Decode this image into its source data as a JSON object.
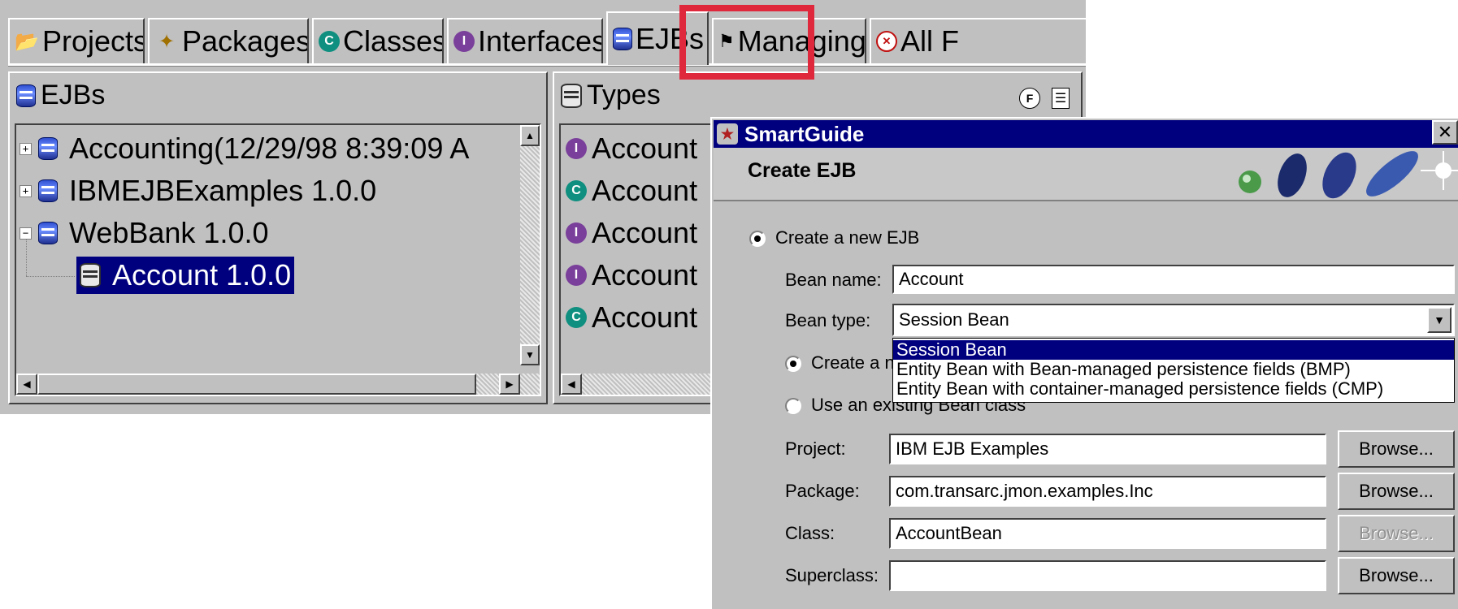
{
  "tabs": [
    {
      "label": "Projects",
      "icon": "folder-icon"
    },
    {
      "label": "Packages",
      "icon": "package-icon"
    },
    {
      "label": "Classes",
      "icon": "class-icon"
    },
    {
      "label": "Interfaces",
      "icon": "interface-icon"
    },
    {
      "label": "EJBs",
      "icon": "ejb-icon"
    },
    {
      "label": "Managing",
      "icon": "managing-icon"
    },
    {
      "label": "All F",
      "icon": "all-problems-icon"
    }
  ],
  "ejbs_pane": {
    "title": "EJBs",
    "tree": [
      {
        "label": "Accounting(12/29/98 8:39:09 A",
        "expander": "+"
      },
      {
        "label": "IBMEJBExamples 1.0.0",
        "expander": "+"
      },
      {
        "label": "WebBank 1.0.0",
        "expander": "−"
      },
      {
        "label": "Account 1.0.0",
        "selected": true
      }
    ]
  },
  "types_pane": {
    "title": "Types",
    "items": [
      {
        "label": "Account",
        "kind": "interface"
      },
      {
        "label": "Account",
        "kind": "class"
      },
      {
        "label": "Account",
        "kind": "interface"
      },
      {
        "label": "Account",
        "kind": "interface"
      },
      {
        "label": "Account",
        "kind": "class"
      }
    ]
  },
  "dialog": {
    "title": "SmartGuide",
    "subtitle": "Create EJB",
    "create_new_label": "Create a new EJB",
    "bean_name_label": "Bean name:",
    "bean_name_value": "Account",
    "bean_type_label": "Bean type:",
    "bean_type_value": "Session Bean",
    "bean_type_options": [
      "Session Bean",
      "Entity Bean with Bean-managed persistence fields (BMP)",
      "Entity Bean with container-managed persistence fields (CMP)"
    ],
    "create_new_class_label": "Create a n",
    "use_existing_label": "Use an existing Bean class",
    "project_label": "Project:",
    "project_value": "IBM EJB Examples",
    "package_label": "Package:",
    "package_value": "com.transarc.jmon.examples.Inc",
    "class_label": "Class:",
    "class_value": "AccountBean",
    "superclass_label": "Superclass:",
    "superclass_value": "",
    "browse_label": "Browse..."
  },
  "colors": {
    "highlight_box": "#e0283c",
    "selection": "#00007f",
    "titlebar": "#00007f"
  }
}
